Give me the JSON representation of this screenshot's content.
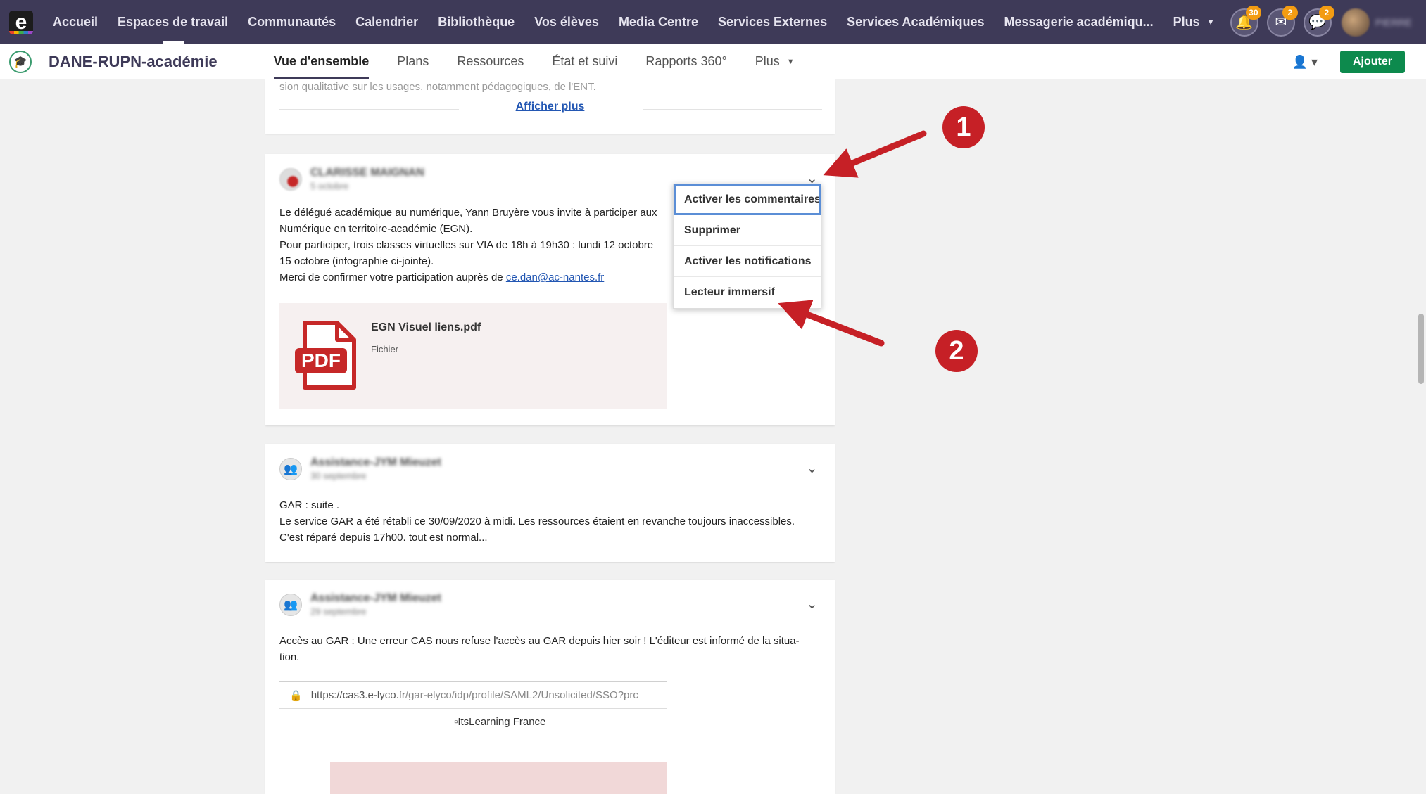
{
  "topnav": {
    "items": [
      "Accueil",
      "Espaces de travail",
      "Communautés",
      "Calendrier",
      "Bibliothèque",
      "Vos élèves",
      "Media Centre",
      "Services Externes",
      "Services Académiques",
      "Messagerie académiqu..."
    ],
    "more_label": "Plus",
    "badges": {
      "notifications": "30",
      "mail": "2",
      "chat": "2"
    },
    "user_name": "PIERRE"
  },
  "subbar": {
    "workspace_title": "DANE-RUPN-académie",
    "tabs": [
      "Vue d'ensemble",
      "Plans",
      "Ressources",
      "État et suivi",
      "Rapports 360°"
    ],
    "more_label": "Plus",
    "add_label": "Ajouter"
  },
  "top_card": {
    "faded_text": "sion qualitative sur les usages, notamment pédagogiques, de l'ENT.",
    "more_link": "Afficher plus"
  },
  "post1": {
    "author": "CLARISSE MAIGNAN",
    "date": "5 octobre",
    "lines": [
      "Le délégué académique au numérique, Yann Bruyère vous invite à participer aux",
      "Numérique en territoire-académie (EGN).",
      "Pour participer, trois classes virtuelles sur VIA de 18h à 19h30 : lundi 12 octobre",
      "15 octobre (infographie ci-jointe)."
    ],
    "confirm_prefix": "Merci de confirmer votre participation auprès de ",
    "confirm_email": "ce.dan@ac-nantes.fr",
    "attachment": {
      "name": "EGN Visuel liens.pdf",
      "type": "Fichier",
      "icon_label": "PDF"
    }
  },
  "dropdown": {
    "items": [
      "Activer les commentaires",
      "Supprimer",
      "Activer les notifications",
      "Lecteur immersif"
    ]
  },
  "post2": {
    "author": "Assistance-JYM Mieuzet",
    "date": "30 septembre",
    "lines": [
      "GAR : suite .",
      "Le service GAR a été rétabli ce 30/09/2020 à midi. Les ressources étaient en revanche toujours inaccessibles.",
      "C'est réparé depuis 17h00. tout est normal..."
    ]
  },
  "post3": {
    "author": "Assistance-JYM Mieuzet",
    "date": "29 septembre",
    "lines": [
      "Accès au GAR : Une erreur CAS nous refuse l'accès au GAR depuis hier soir ! L'éditeur est informé de la situa-",
      "tion."
    ],
    "url_host": "https://cas3.e-lyco.fr",
    "url_path": "/gar-elyco/idp/profile/SAML2/Unsolicited/SSO?prc",
    "image_alt": "ItsLearning France"
  },
  "annotations": {
    "first": "1",
    "second": "2"
  },
  "colors": {
    "topbar": "#3e3a58",
    "accent_green": "#0d8a4d",
    "annotation_red": "#c62026",
    "badge_orange": "#f39c12",
    "link_blue": "#2357b3"
  }
}
